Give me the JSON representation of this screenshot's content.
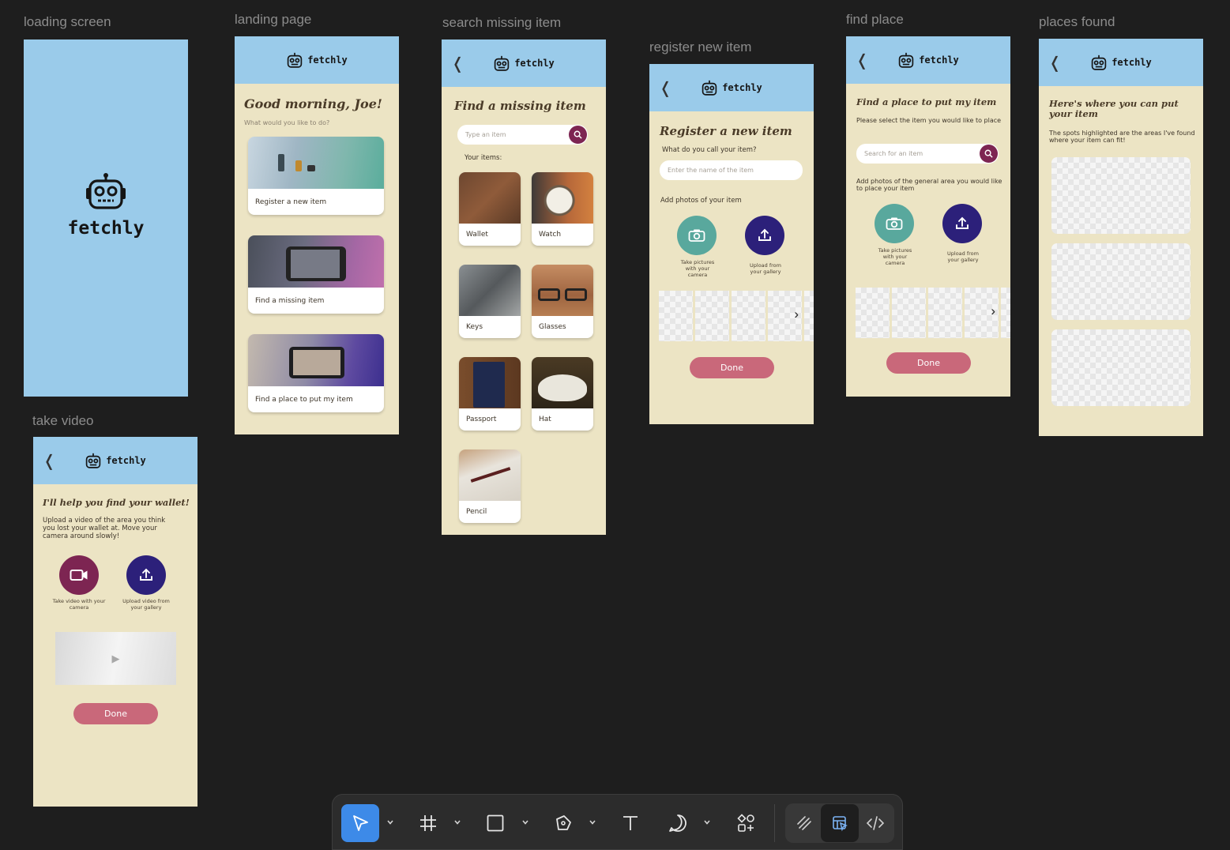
{
  "canvas": {
    "frames": [
      {
        "id": "loading",
        "label": "loading screen"
      },
      {
        "id": "landing",
        "label": "landing page"
      },
      {
        "id": "search",
        "label": "search missing item"
      },
      {
        "id": "register",
        "label": "register new item"
      },
      {
        "id": "findplace",
        "label": "find place"
      },
      {
        "id": "placesfound",
        "label": "places found"
      },
      {
        "id": "takevideo",
        "label": "take video"
      }
    ]
  },
  "app": {
    "name": "fetchly",
    "back_icon": "chevron-left-icon",
    "logo_icon": "robot-icon"
  },
  "landing": {
    "greeting": "Good morning, Joe!",
    "prompt": "What would you like to do?",
    "cards": [
      {
        "label": "Register a new item"
      },
      {
        "label": "Find a missing item"
      },
      {
        "label": "Find a place to put my item"
      }
    ]
  },
  "search": {
    "title": "Find a missing item",
    "placeholder": "Type an item",
    "items_label": "Your items:",
    "items": [
      {
        "label": "Wallet"
      },
      {
        "label": "Watch"
      },
      {
        "label": "Keys"
      },
      {
        "label": "Glasses"
      },
      {
        "label": "Passport"
      },
      {
        "label": "Hat"
      },
      {
        "label": "Pencil"
      }
    ]
  },
  "register": {
    "title": "Register a new item",
    "name_question": "What do you call your item?",
    "name_placeholder": "Enter the name of the item",
    "photos_label": "Add photos of your item",
    "camera_caption": "Take pictures with your camera",
    "upload_caption": "Upload from your gallery",
    "done": "Done"
  },
  "findplace": {
    "title": "Find a place to put my item",
    "instruction": "Please select the item you would like to place",
    "placeholder": "Search for an item",
    "photos_label": "Add photos of the general area you would like to place your item",
    "camera_caption": "Take pictures with your camera",
    "upload_caption": "Upload from your gallery",
    "done": "Done"
  },
  "placesfound": {
    "title": "Here's where you can put your item",
    "description": "The spots highlighted are the areas I've found where your item can fit!"
  },
  "takevideo": {
    "title": "I'll help you find your wallet!",
    "instruction": "Upload a video of the area you think you lost your wallet at. Move your camera around slowly!",
    "camera_caption": "Take video with your camera",
    "upload_caption": "Upload video from your gallery",
    "done": "Done"
  },
  "toolbar": {
    "tools": [
      "move-tool",
      "frame-tool",
      "rectangle-tool",
      "pen-tool",
      "text-tool",
      "comment-tool",
      "components-tool",
      "draw-mode",
      "design-mode",
      "dev-mode"
    ],
    "active_tool": "move-tool",
    "active_color": "#3d8ae8"
  },
  "colors": {
    "header": "#9acbea",
    "background": "#ece4c4",
    "plum": "#7d2552",
    "teal": "#59a89d",
    "navy": "#2c207a",
    "done": "#c9687a"
  }
}
